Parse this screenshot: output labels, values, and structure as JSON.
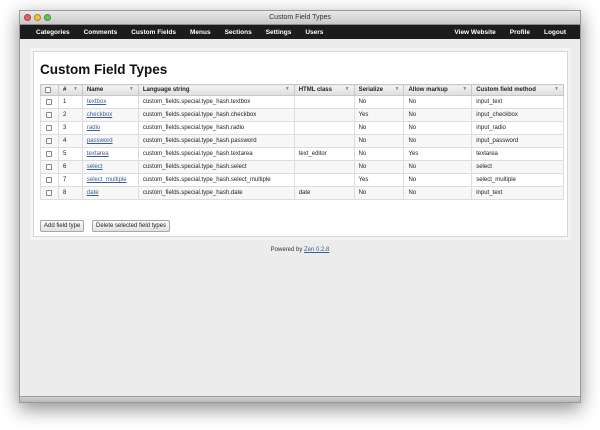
{
  "window": {
    "title": "Custom Field Types"
  },
  "nav": {
    "left": [
      "Categories",
      "Comments",
      "Custom Fields",
      "Menus",
      "Sections",
      "Settings",
      "Users"
    ],
    "right": [
      "View Website",
      "Profile",
      "Logout"
    ]
  },
  "page": {
    "title": "Custom Field Types"
  },
  "table": {
    "columns": [
      "#",
      "Name",
      "Language string",
      "HTML class",
      "Serialize",
      "Allow markup",
      "Custom field method"
    ],
    "rows": [
      {
        "id": "1",
        "name": "textbox",
        "lang": "custom_fields.special.type_hash.textbox",
        "html_class": "",
        "serialize": "No",
        "markup": "No",
        "method": "input_text"
      },
      {
        "id": "2",
        "name": "checkbox",
        "lang": "custom_fields.special.type_hash.checkbox",
        "html_class": "",
        "serialize": "Yes",
        "markup": "No",
        "method": "input_checkbox"
      },
      {
        "id": "3",
        "name": "radio",
        "lang": "custom_fields.special.type_hash.radio",
        "html_class": "",
        "serialize": "No",
        "markup": "No",
        "method": "input_radio"
      },
      {
        "id": "4",
        "name": "password",
        "lang": "custom_fields.special.type_hash.password",
        "html_class": "",
        "serialize": "No",
        "markup": "No",
        "method": "input_password"
      },
      {
        "id": "5",
        "name": "textarea",
        "lang": "custom_fields.special.type_hash.textarea",
        "html_class": "text_editor",
        "serialize": "No",
        "markup": "Yes",
        "method": "textarea"
      },
      {
        "id": "6",
        "name": "select",
        "lang": "custom_fields.special.type_hash.select",
        "html_class": "",
        "serialize": "No",
        "markup": "No",
        "method": "select"
      },
      {
        "id": "7",
        "name": "select_multiple",
        "lang": "custom_fields.special.type_hash.select_multiple",
        "html_class": "",
        "serialize": "Yes",
        "markup": "No",
        "method": "select_multiple"
      },
      {
        "id": "8",
        "name": "date",
        "lang": "custom_fields.special.type_hash.date",
        "html_class": "date",
        "serialize": "No",
        "markup": "No",
        "method": "input_text"
      }
    ]
  },
  "buttons": {
    "add": "Add field type",
    "delete": "Delete selected field types"
  },
  "footer": {
    "prefix": "Powered by",
    "link": "Zen 0.2.8"
  },
  "icons": {
    "sort": "sort-arrow-icon",
    "checkbox": "checkbox-icon"
  }
}
